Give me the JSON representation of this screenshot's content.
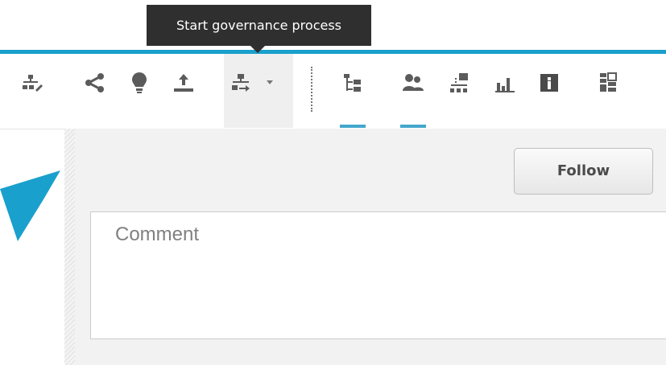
{
  "tooltip": {
    "text": "Start governance process"
  },
  "toolbar": {
    "buttons": [
      {
        "icon": "workflow-edit-icon"
      },
      {
        "icon": "share-icon"
      },
      {
        "icon": "lightbulb-icon"
      },
      {
        "icon": "upload-icon"
      },
      {
        "icon": "start-governance-process-icon"
      },
      {
        "icon": "chevron-down-icon"
      },
      {
        "icon": "hierarchy-icon"
      },
      {
        "icon": "people-icon"
      },
      {
        "icon": "structure-icon"
      },
      {
        "icon": "bar-chart-icon"
      },
      {
        "icon": "info-icon"
      },
      {
        "icon": "dashboard-icon"
      }
    ]
  },
  "main": {
    "follow_label": "Follow",
    "comment_placeholder": "Comment"
  },
  "colors": {
    "accent": "#1aa0cc",
    "tab_indicator": "#45a7cc",
    "icon": "#5b5b5b",
    "tooltip_bg": "#2f2f2f"
  }
}
